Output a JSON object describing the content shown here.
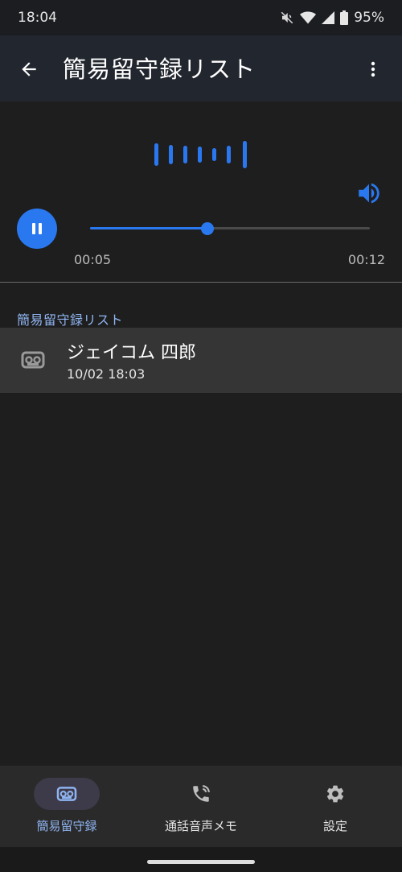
{
  "status_bar": {
    "time": "18:04",
    "battery": "95%",
    "icons": [
      "mute-icon",
      "wifi-icon",
      "signal-icon",
      "battery-icon"
    ]
  },
  "app_bar": {
    "title": "簡易留守録リスト",
    "back_icon": "arrow-back-icon",
    "menu_icon": "more-vert-icon"
  },
  "player": {
    "state": "playing",
    "current_time": "00:05",
    "total_time": "00:12",
    "progress_fraction": 0.42,
    "accent_color": "#2a78f0",
    "icons": [
      "waveform-icon",
      "volume-icon",
      "pause-icon"
    ]
  },
  "list": {
    "section_title": "簡易留守録リスト",
    "items": [
      {
        "name": "ジェイコム 四郎",
        "datetime": "10/02 18:03",
        "icon": "voicemail-icon"
      }
    ]
  },
  "bottom_nav": {
    "items": [
      {
        "label": "簡易留守録",
        "icon": "voicemail-icon",
        "active": true
      },
      {
        "label": "通話音声メモ",
        "icon": "phone-record-icon",
        "active": false
      },
      {
        "label": "設定",
        "icon": "gear-icon",
        "active": false
      }
    ]
  }
}
